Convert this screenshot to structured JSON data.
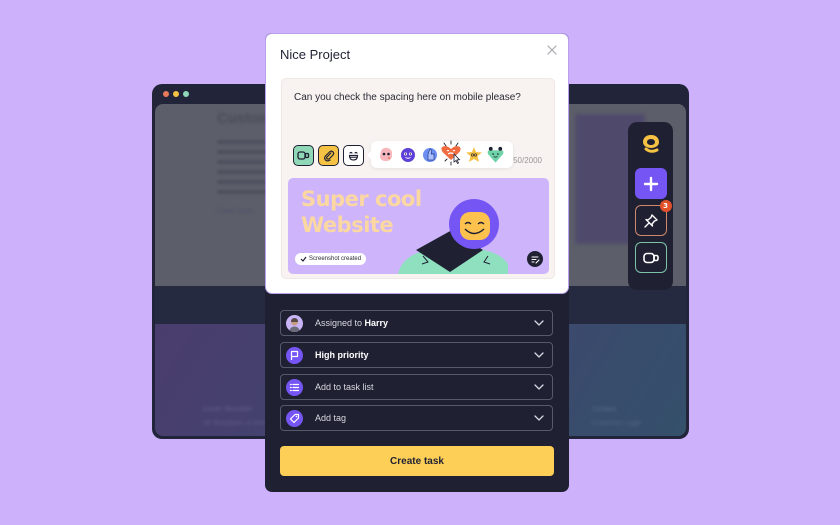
{
  "background_window": {
    "traffic_lights": [
      "#e7795b",
      "#f6c244",
      "#8fd7b6"
    ],
    "blurred_heading": "Custom",
    "blurred_link": "Learn more",
    "blurred_footer_left": [
      "Cover Structure",
      "All Templates & Docs"
    ],
    "blurred_footer_right": [
      "Contact",
      "Customer Login"
    ]
  },
  "side_toolbar": {
    "logo": "q-logo-icon",
    "buttons": [
      {
        "name": "add",
        "icon": "plus-icon"
      },
      {
        "name": "pin",
        "icon": "pushpin-icon",
        "badge": "3"
      },
      {
        "name": "record",
        "icon": "video-camera-icon"
      }
    ]
  },
  "modal": {
    "title": "Nice Project",
    "close_icon": "close-icon",
    "composer": {
      "message": "Can you check the spacing here on mobile please?",
      "tools": [
        "video-camera-icon",
        "paperclip-icon",
        "smile-icon"
      ],
      "emoji_options": [
        "pink-blob-emoji",
        "purple-blob-emoji",
        "thumbs-up-emoji",
        "heart-emoji",
        "star-emoji",
        "green-heart-emoji"
      ],
      "selected_emoji": "heart-emoji",
      "char_counter": "50/2000",
      "screenshot": {
        "title_line1": "Super cool",
        "title_line2": "Website",
        "status_label": "Screenshot created"
      }
    },
    "fields": [
      {
        "name": "assignee",
        "prefix": "Assigned to ",
        "value": "Harry",
        "icon": "avatar"
      },
      {
        "name": "priority",
        "prefix": "",
        "value": "High priority",
        "icon": "flag-icon"
      },
      {
        "name": "task-list",
        "prefix": "Add to task list",
        "value": "",
        "icon": "list-icon"
      },
      {
        "name": "tag",
        "prefix": "Add tag",
        "value": "",
        "icon": "tag-icon"
      }
    ],
    "create_label": "Create task"
  },
  "colors": {
    "page_bg": "#cdb2fb",
    "accent": "#7655f5",
    "cta": "#fecf57",
    "dark": "#1f2133"
  }
}
